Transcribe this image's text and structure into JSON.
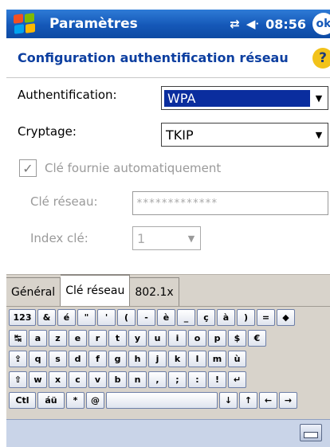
{
  "titlebar": {
    "app_title": "Paramètres",
    "time": "08:56",
    "ok_label": "ok"
  },
  "dialog": {
    "title": "Configuration authentification réseau",
    "help_label": "?"
  },
  "form": {
    "auth_label": "Authentification:",
    "auth_value": "WPA",
    "crypt_label": "Cryptage:",
    "crypt_value": "TKIP",
    "auto_key_label": "Clé fournie automatiquement",
    "auto_key_checked": true,
    "network_key_label": "Clé réseau:",
    "network_key_value": "*************",
    "key_index_label": "Index clé:",
    "key_index_value": "1"
  },
  "tabs": [
    {
      "label": "Général",
      "active": false
    },
    {
      "label": "Clé réseau",
      "active": true
    },
    {
      "label": "802.1x",
      "active": false
    }
  ],
  "keyboard": {
    "row1": [
      "123",
      "&",
      "é",
      "\"",
      "'",
      "(",
      "-",
      "è",
      "_",
      "ç",
      "à",
      ")",
      "=",
      "◆"
    ],
    "row2": [
      "↹",
      "a",
      "z",
      "e",
      "r",
      "t",
      "y",
      "u",
      "i",
      "o",
      "p",
      "$",
      "€"
    ],
    "row3": [
      "⇪",
      "q",
      "s",
      "d",
      "f",
      "g",
      "h",
      "j",
      "k",
      "l",
      "m",
      "ù"
    ],
    "row4": [
      "⇧",
      "w",
      "x",
      "c",
      "v",
      "b",
      "n",
      ",",
      ";",
      ":",
      "!",
      "↵"
    ],
    "row5": [
      "Ctl",
      "áü",
      "*",
      "@",
      " ",
      "↓",
      "↑",
      "←",
      "→"
    ]
  },
  "colors": {
    "titlebar": "#1558b8",
    "selection": "#0a2d9e",
    "dialog_title": "#0d3fa0"
  }
}
